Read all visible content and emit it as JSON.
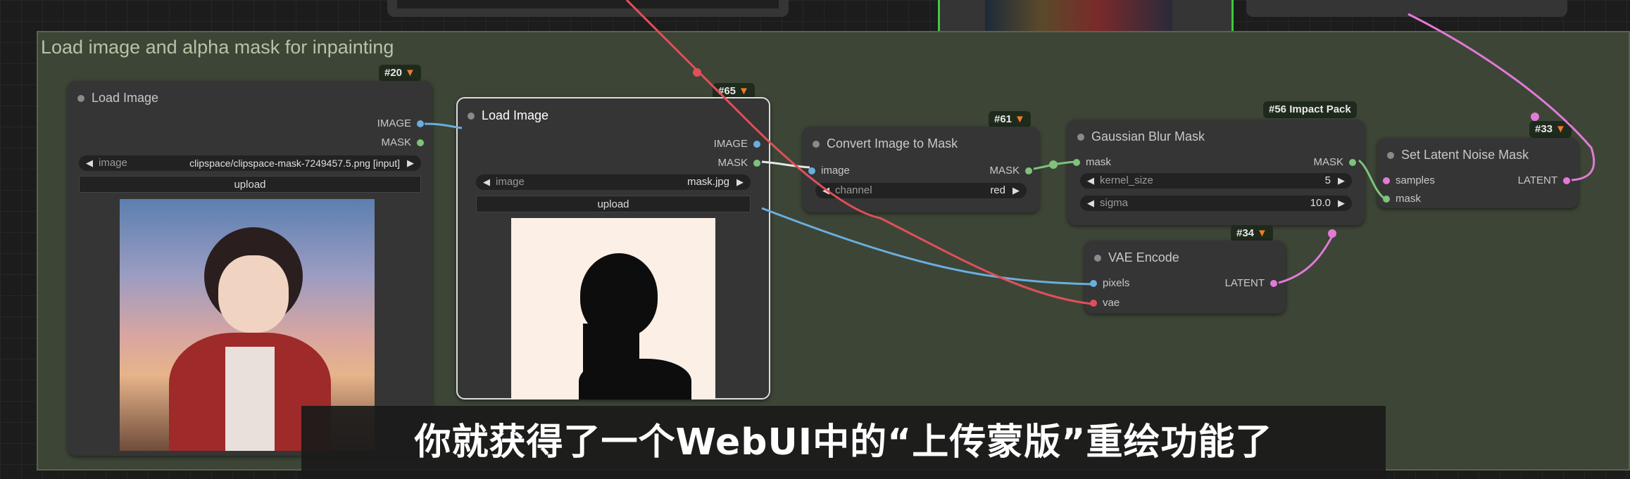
{
  "group": {
    "title": "Load image and alpha mask for inpainting"
  },
  "nodes": {
    "load_image_1": {
      "badge": "#20",
      "title": "Load Image",
      "outputs": [
        "IMAGE",
        "MASK"
      ],
      "widget_label": "image",
      "widget_value": "clipspace/clipspace-mask-7249457.5.png [input]",
      "upload_label": "upload"
    },
    "load_image_2": {
      "badge": "#65",
      "title": "Load Image",
      "outputs": [
        "IMAGE",
        "MASK"
      ],
      "widget_label": "image",
      "widget_value": "mask.jpg",
      "upload_label": "upload"
    },
    "convert": {
      "badge": "#61",
      "title": "Convert Image to Mask",
      "input": "image",
      "output": "MASK",
      "widget_label": "channel",
      "widget_value": "red"
    },
    "gaussian": {
      "badge": "#56 Impact Pack",
      "title": "Gaussian Blur Mask",
      "input": "mask",
      "output": "MASK",
      "w1_label": "kernel_size",
      "w1_value": "5",
      "w2_label": "sigma",
      "w2_value": "10.0"
    },
    "latent_mask": {
      "badge": "#33",
      "title": "Set Latent Noise Mask",
      "inputs": [
        "samples",
        "mask"
      ],
      "output": "LATENT"
    },
    "vae_encode": {
      "badge": "#34",
      "title": "VAE Encode",
      "inputs": [
        "pixels",
        "vae"
      ],
      "output": "LATENT"
    }
  },
  "subtitle": "你就获得了一个WebUI中的“上传蒙版”重绘功能了",
  "colors": {
    "image_link": "#6aaede",
    "mask_link": "#7fc27b",
    "vae_link": "#e0505a",
    "latent_link": "#e27ad8",
    "group_bg": "#3d4537"
  }
}
